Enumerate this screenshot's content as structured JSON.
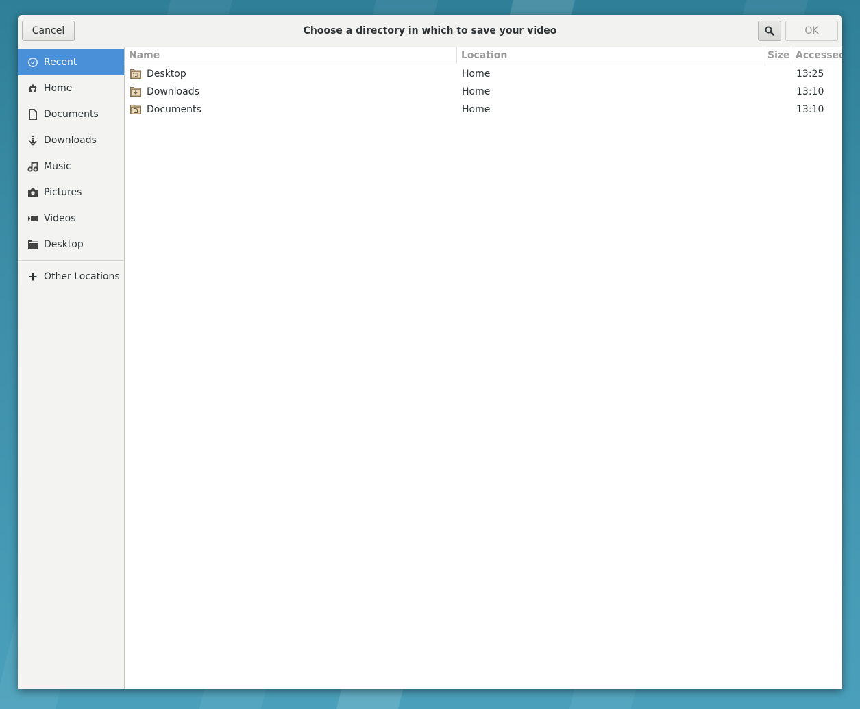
{
  "dialog": {
    "title": "Choose a directory in which to save your video",
    "cancel_label": "Cancel",
    "ok_label": "OK",
    "search_icon": "search-icon"
  },
  "sidebar": {
    "items": [
      {
        "label": "Recent",
        "icon": "clock-icon",
        "active": true
      },
      {
        "label": "Home",
        "icon": "home-icon"
      },
      {
        "label": "Documents",
        "icon": "document-icon"
      },
      {
        "label": "Downloads",
        "icon": "download-icon"
      },
      {
        "label": "Music",
        "icon": "music-icon"
      },
      {
        "label": "Pictures",
        "icon": "camera-icon"
      },
      {
        "label": "Videos",
        "icon": "video-icon"
      },
      {
        "label": "Desktop",
        "icon": "folder-icon"
      }
    ],
    "other_locations": {
      "label": "Other Locations",
      "icon": "plus-icon"
    }
  },
  "file_list": {
    "columns": [
      "Name",
      "Location",
      "Size",
      "Accessed"
    ],
    "rows": [
      {
        "name": "Desktop",
        "location": "Home",
        "size": "",
        "accessed": "13:25",
        "icon": "desktop-folder-icon"
      },
      {
        "name": "Downloads",
        "location": "Home",
        "size": "",
        "accessed": "13:10",
        "icon": "downloads-folder-icon"
      },
      {
        "name": "Documents",
        "location": "Home",
        "size": "",
        "accessed": "13:10",
        "icon": "documents-folder-icon"
      }
    ]
  },
  "colors": {
    "accent": "#4a90d9",
    "sidebar_bg": "#f3f3f2",
    "header_bg": "#f2f2f1"
  }
}
